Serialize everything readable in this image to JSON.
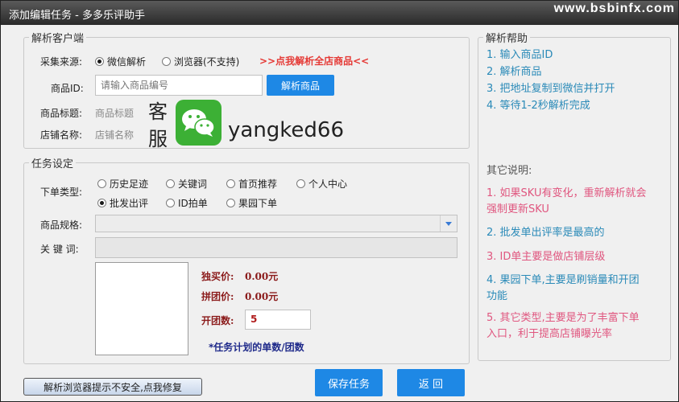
{
  "window": {
    "title": "添加编辑任务 - 多多乐评助手",
    "watermark": "www.bsbinfx.com"
  },
  "client": {
    "legend": "解析客户端",
    "source_label": "采集来源:",
    "source_options": [
      "微信解析",
      "浏览器(不支持)"
    ],
    "promo_link": ">>点我解析全店商品<<",
    "product_id_label": "商品ID:",
    "product_id_placeholder": "请输入商品编号",
    "parse_button": "解析商品",
    "product_title_label": "商品标题:",
    "product_title_value": "商品标题",
    "shop_name_label": "店铺名称:",
    "shop_name_value": "店铺名称",
    "overlay": {
      "kf_char1": "客",
      "kf_char2": "服",
      "wechat_id": "yangked66"
    }
  },
  "task": {
    "legend": "任务设定",
    "order_type_label": "下单类型:",
    "order_types_row1": [
      "历史足迹",
      "关键词",
      "首页推荐",
      "个人中心"
    ],
    "order_types_row2": [
      "批发出评",
      "ID拍单",
      "果园下单"
    ],
    "spec_label": "商品规格:",
    "keyword_label": "关 键 词:",
    "solo_price_label": "独买价:",
    "solo_price_value": "0.00元",
    "group_price_label": "拼团价:",
    "group_price_value": "0.00元",
    "group_count_label": "开团数:",
    "group_count_value": "5",
    "note": "*任务计划的单数/团数"
  },
  "help": {
    "legend": "解析帮助",
    "steps": [
      "1. 输入商品ID",
      "2. 解析商品",
      "3. 把地址复制到微信并打开",
      "4. 等待1-2秒解析完成"
    ],
    "other_title": "其它说明:",
    "notes": [
      {
        "line1": "1. 如果SKU有变化，重新解析就会",
        "line2": "强制更新SKU"
      },
      {
        "line1": "2. 批发单出评率是最高的",
        "line2": ""
      },
      {
        "line1": "3. ID单主要是做店铺层级",
        "line2": ""
      },
      {
        "line1": "4. 果园下单,主要是刷销量和开团",
        "line2": "功能"
      },
      {
        "line1": "5. 其它类型,主要是为了丰富下单",
        "line2": "入口，利于提高店铺曝光率"
      }
    ]
  },
  "footer": {
    "fix_button": "解析浏览器提示不安全,点我修复",
    "save_button": "保存任务",
    "back_button": "返 回"
  },
  "colors": {
    "accent_blue": "#1e88e5",
    "help_blue": "#2a8ab8",
    "help_pink": "#e0567f",
    "wechat_green": "#3cb035"
  }
}
